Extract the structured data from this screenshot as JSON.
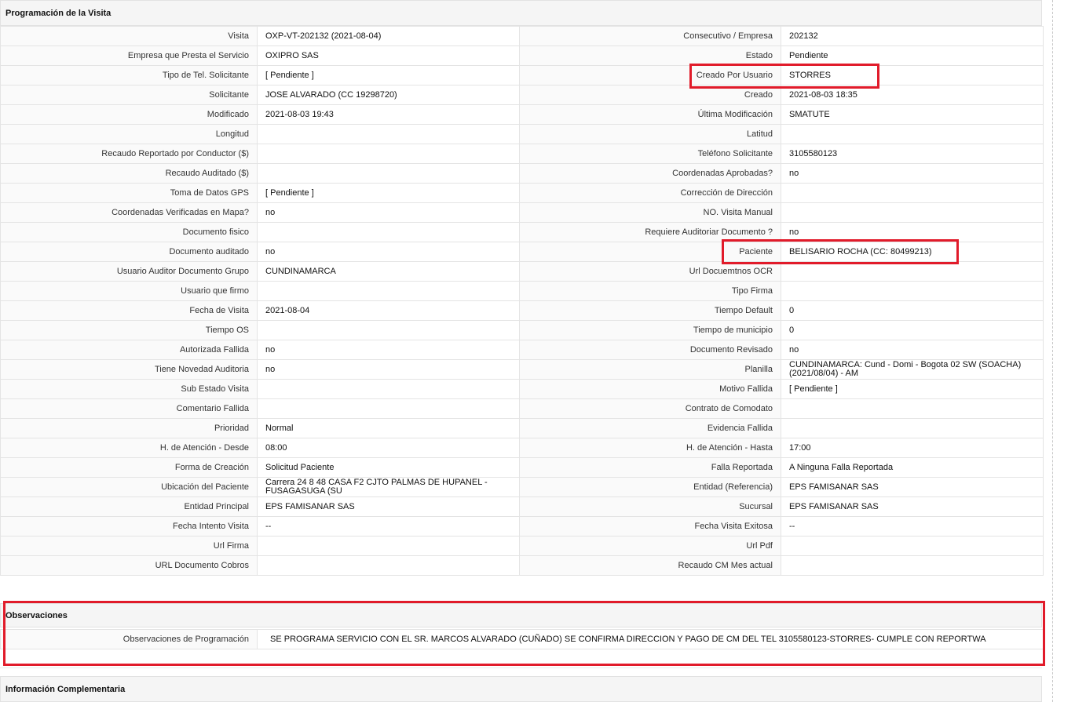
{
  "sections": {
    "programacion": "Programación de la Visita",
    "observaciones": "Observaciones",
    "info": "Información Complementaria"
  },
  "rows": [
    {
      "l1": "Visita",
      "v1": "OXP-VT-202132 (2021-08-04)",
      "l2": "Consecutivo / Empresa",
      "v2": "202132"
    },
    {
      "l1": "Empresa que Presta el Servicio",
      "v1": "OXIPRO SAS",
      "l2": "Estado",
      "v2": "Pendiente"
    },
    {
      "l1": "Tipo de Tel. Solicitante",
      "v1": "[ Pendiente ]",
      "l2": "Creado Por Usuario",
      "v2": "STORRES"
    },
    {
      "l1": "Solicitante",
      "v1": "JOSE ALVARADO (CC 19298720)",
      "l2": "Creado",
      "v2": "2021-08-03 18:35"
    },
    {
      "l1": "Modificado",
      "v1": "2021-08-03 19:43",
      "l2": "Última Modificación",
      "v2": " SMATUTE"
    },
    {
      "l1": "Longitud",
      "v1": "",
      "l2": "Latitud",
      "v2": ""
    },
    {
      "l1": "Recaudo Reportado por Conductor ($)",
      "v1": "",
      "l2": "Teléfono Solicitante",
      "v2": "3105580123"
    },
    {
      "l1": "Recaudo Auditado ($)",
      "v1": "",
      "l2": "Coordenadas Aprobadas?",
      "v2": " no"
    },
    {
      "l1": "Toma de Datos GPS",
      "v1": "[ Pendiente ]",
      "l2": "Corrección de Dirección",
      "v2": ""
    },
    {
      "l1": "Coordenadas Verificadas en Mapa?",
      "v1": " no",
      "l2": "NO. Visita Manual",
      "v2": ""
    },
    {
      "l1": "Documento fisico",
      "v1": "",
      "l2": "Requiere Auditoriar Documento ?",
      "v2": " no"
    },
    {
      "l1": "Documento auditado",
      "v1": " no",
      "l2": "Paciente",
      "v2": "BELISARIO ROCHA (CC: 80499213)"
    },
    {
      "l1": "Usuario Auditor Documento Grupo",
      "v1": "CUNDINAMARCA",
      "l2": "Url Docuemtnos OCR",
      "v2": ""
    },
    {
      "l1": "Usuario que firmo",
      "v1": "",
      "l2": "Tipo Firma",
      "v2": ""
    },
    {
      "l1": "Fecha de Visita",
      "v1": " 2021-08-04",
      "l2": "Tiempo Default",
      "v2": "0"
    },
    {
      "l1": "Tiempo OS",
      "v1": "",
      "l2": "Tiempo de municipio",
      "v2": "0"
    },
    {
      "l1": "Autorizada Fallida",
      "v1": " no",
      "l2": "Documento Revisado",
      "v2": " no"
    },
    {
      "l1": "Tiene Novedad Auditoria",
      "v1": " no",
      "l2": "Planilla",
      "v2": "CUNDINAMARCA: Cund - Domi - Bogota 02 SW (SOACHA) (2021/08/04) - AM"
    },
    {
      "l1": "Sub Estado Visita",
      "v1": "",
      "l2": "Motivo Fallida",
      "v2": "[ Pendiente ]"
    },
    {
      "l1": "Comentario Fallida",
      "v1": "",
      "l2": "Contrato de Comodato",
      "v2": ""
    },
    {
      "l1": "Prioridad",
      "v1": "Normal",
      "l2": "Evidencia Fallida",
      "v2": ""
    },
    {
      "l1": "H. de Atención - Desde",
      "v1": "08:00",
      "l2": "H. de Atención - Hasta",
      "v2": "17:00"
    },
    {
      "l1": "Forma de Creación",
      "v1": "Solicitud Paciente",
      "l2": "Falla Reportada",
      "v2": "A Ninguna Falla Reportada"
    },
    {
      "l1": "Ubicación del Paciente",
      "v1": "Carrera 24 8 48 CASA F2 CJTO PALMAS DE HUPANEL - FUSAGASUGA (SU",
      "l2": "Entidad (Referencia)",
      "v2": "EPS FAMISANAR SAS"
    },
    {
      "l1": "Entidad Principal",
      "v1": "EPS FAMISANAR SAS",
      "l2": "Sucursal",
      "v2": "EPS FAMISANAR SAS"
    },
    {
      "l1": "Fecha Intento Visita",
      "v1": " --",
      "l2": "Fecha Visita Exitosa",
      "v2": " --"
    },
    {
      "l1": "Url Firma",
      "v1": "",
      "l2": "Url Pdf",
      "v2": ""
    },
    {
      "l1": "URL Documento Cobros",
      "v1": "",
      "l2": "Recaudo CM Mes actual",
      "v2": ""
    }
  ],
  "observaciones": {
    "label": "Observaciones de Programación",
    "value": "SE PROGRAMA SERVICIO CON EL SR. MARCOS ALVARADO (CUÑADO) SE CONFIRMA DIRECCION Y PAGO DE CM DEL TEL 3105580123-STORRES- CUMPLE CON REPORTWA"
  },
  "highlight_color": "#e11b2a"
}
